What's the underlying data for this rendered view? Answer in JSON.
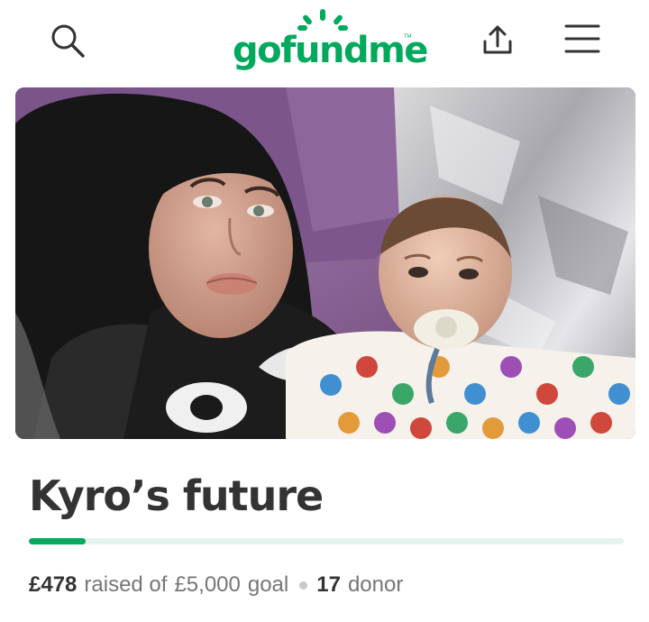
{
  "header": {
    "logo_text": "gofundme",
    "logo_tm": "TM",
    "search_icon": "search-icon",
    "share_icon": "share-icon",
    "menu_icon": "hamburger-menu-icon"
  },
  "campaign": {
    "title": "Kyro’s future",
    "photo_alt": "Photo of a woman with a baby",
    "progress": 0.0956,
    "raised": "£478",
    "raised_text": "raised of",
    "goal": "£5,000",
    "goal_text": "goal",
    "donor_count": "17",
    "donor_text": "donor"
  },
  "colors": {
    "brand_green": "#02a95c",
    "progress_track": "#e4f3ec",
    "text_dark": "#333333",
    "text_muted": "#767676"
  }
}
